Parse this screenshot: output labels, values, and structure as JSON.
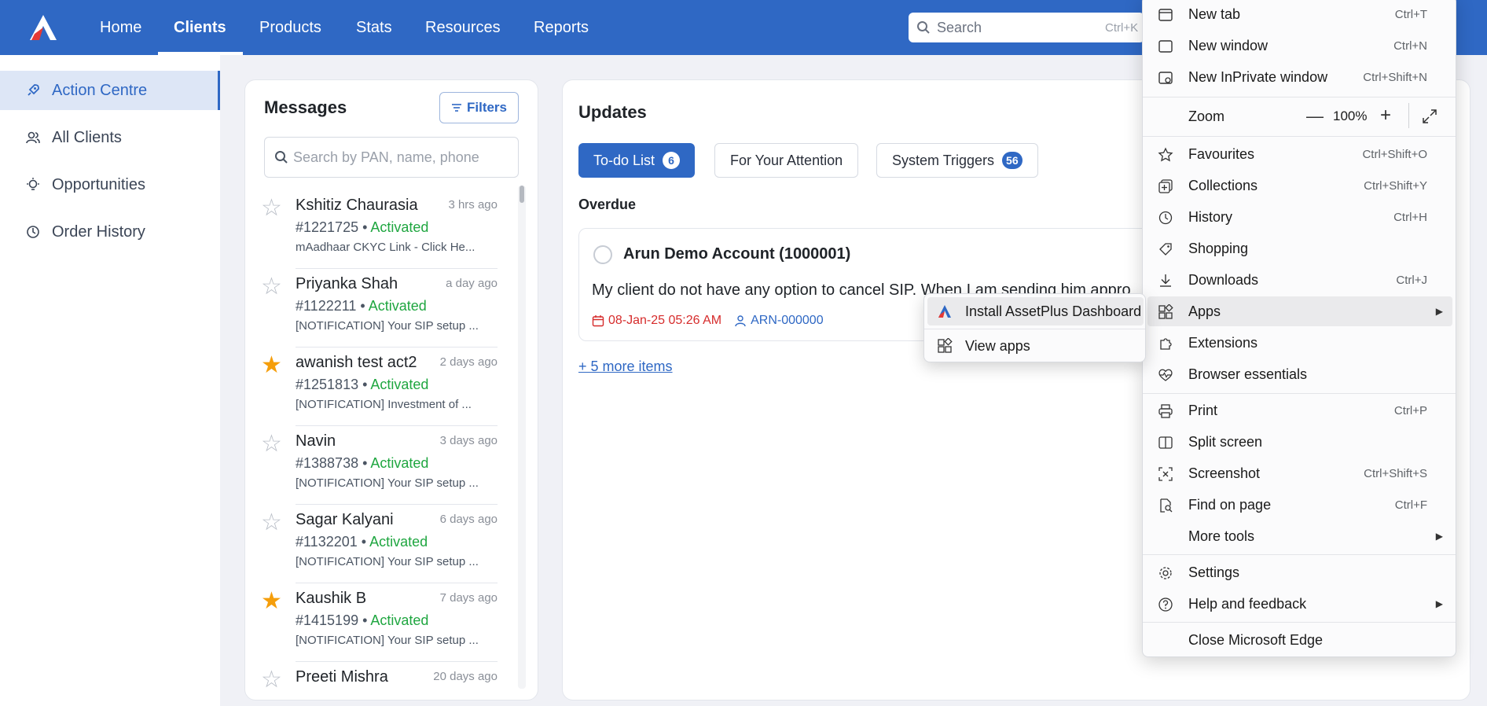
{
  "nav": {
    "items": [
      {
        "label": "Home"
      },
      {
        "label": "Clients"
      },
      {
        "label": "Products"
      },
      {
        "label": "Stats"
      },
      {
        "label": "Resources"
      },
      {
        "label": "Reports"
      }
    ],
    "active": "Clients",
    "search_placeholder": "Search",
    "search_shortcut": "Ctrl+K"
  },
  "sidebar": {
    "items": [
      {
        "label": "Action Centre",
        "icon": "rocket-icon"
      },
      {
        "label": "All Clients",
        "icon": "users-icon"
      },
      {
        "label": "Opportunities",
        "icon": "lightbulb-icon"
      },
      {
        "label": "Order History",
        "icon": "history-icon"
      }
    ],
    "active": "Action Centre"
  },
  "messages": {
    "title": "Messages",
    "filters_label": "Filters",
    "search_placeholder": "Search by PAN, name, phone",
    "items": [
      {
        "name": "Kshitiz Chaurasia",
        "time": "3 hrs ago",
        "id": "#1221725",
        "status": "Activated",
        "preview": "mAadhaar CKYC Link - Click He...",
        "starred": false
      },
      {
        "name": "Priyanka Shah",
        "time": "a day ago",
        "id": "#1122211",
        "status": "Activated",
        "preview": "[NOTIFICATION] Your SIP setup ...",
        "starred": false
      },
      {
        "name": "awanish test act2",
        "time": "2 days ago",
        "id": "#1251813",
        "status": "Activated",
        "preview": "[NOTIFICATION] Investment of ...",
        "starred": true
      },
      {
        "name": "Navin",
        "time": "3 days ago",
        "id": "#1388738",
        "status": "Activated",
        "preview": "[NOTIFICATION] Your SIP setup ...",
        "starred": false
      },
      {
        "name": "Sagar Kalyani",
        "time": "6 days ago",
        "id": "#1132201",
        "status": "Activated",
        "preview": "[NOTIFICATION] Your SIP setup ...",
        "starred": false
      },
      {
        "name": "Kaushik B",
        "time": "7 days ago",
        "id": "#1415199",
        "status": "Activated",
        "preview": "[NOTIFICATION] Your SIP setup ...",
        "starred": true
      },
      {
        "name": "Preeti Mishra",
        "time": "20 days ago",
        "id": "",
        "status": "",
        "preview": "",
        "starred": false
      }
    ]
  },
  "updates": {
    "title": "Updates",
    "tabs": [
      {
        "label": "To-do List",
        "count": "6"
      },
      {
        "label": "For Your Attention",
        "count": ""
      },
      {
        "label": "System Triggers",
        "count": "56"
      }
    ],
    "active_tab": "To-do List",
    "section": "Overdue",
    "task": {
      "title": "Arun Demo Account (1000001)",
      "description": "My client do not have any option to cancel SIP. When I am sending him appro",
      "date": "08-Jan-25 05:26 AM",
      "arn": "ARN-000000"
    },
    "more_link": "+ 5 more items"
  },
  "browser_menu": {
    "items": [
      {
        "label": "New tab",
        "shortcut": "Ctrl+T",
        "icon": "new-tab-icon"
      },
      {
        "label": "New window",
        "shortcut": "Ctrl+N",
        "icon": "new-window-icon"
      },
      {
        "label": "New InPrivate window",
        "shortcut": "Ctrl+Shift+N",
        "icon": "inprivate-icon"
      },
      {
        "label": "Zoom",
        "shortcut": "",
        "icon": ""
      },
      {
        "label": "Favourites",
        "shortcut": "Ctrl+Shift+O",
        "icon": "star-icon"
      },
      {
        "label": "Collections",
        "shortcut": "Ctrl+Shift+Y",
        "icon": "collections-icon"
      },
      {
        "label": "History",
        "shortcut": "Ctrl+H",
        "icon": "history-icon"
      },
      {
        "label": "Shopping",
        "shortcut": "",
        "icon": "tag-icon"
      },
      {
        "label": "Downloads",
        "shortcut": "Ctrl+J",
        "icon": "download-icon"
      },
      {
        "label": "Apps",
        "shortcut": "",
        "icon": "apps-icon"
      },
      {
        "label": "Extensions",
        "shortcut": "",
        "icon": "puzzle-icon"
      },
      {
        "label": "Browser essentials",
        "shortcut": "",
        "icon": "heart-pulse-icon"
      },
      {
        "label": "Print",
        "shortcut": "Ctrl+P",
        "icon": "printer-icon"
      },
      {
        "label": "Split screen",
        "shortcut": "",
        "icon": "split-screen-icon"
      },
      {
        "label": "Screenshot",
        "shortcut": "Ctrl+Shift+S",
        "icon": "screenshot-icon"
      },
      {
        "label": "Find on page",
        "shortcut": "Ctrl+F",
        "icon": "find-icon"
      },
      {
        "label": "More tools",
        "shortcut": "",
        "icon": ""
      },
      {
        "label": "Settings",
        "shortcut": "",
        "icon": "gear-icon"
      },
      {
        "label": "Help and feedback",
        "shortcut": "",
        "icon": "help-icon"
      },
      {
        "label": "Close Microsoft Edge",
        "shortcut": "",
        "icon": ""
      }
    ],
    "zoom_value": "100%",
    "apps_submenu": [
      {
        "label": "Install AssetPlus Dashboard",
        "icon": "assetplus-logo-icon"
      },
      {
        "label": "View apps",
        "icon": "apps-icon"
      }
    ]
  },
  "colors": {
    "brand": "#2f68c4",
    "activated": "#1fa640",
    "overdue_date": "#d62c2c",
    "star": "#f59e0b"
  }
}
